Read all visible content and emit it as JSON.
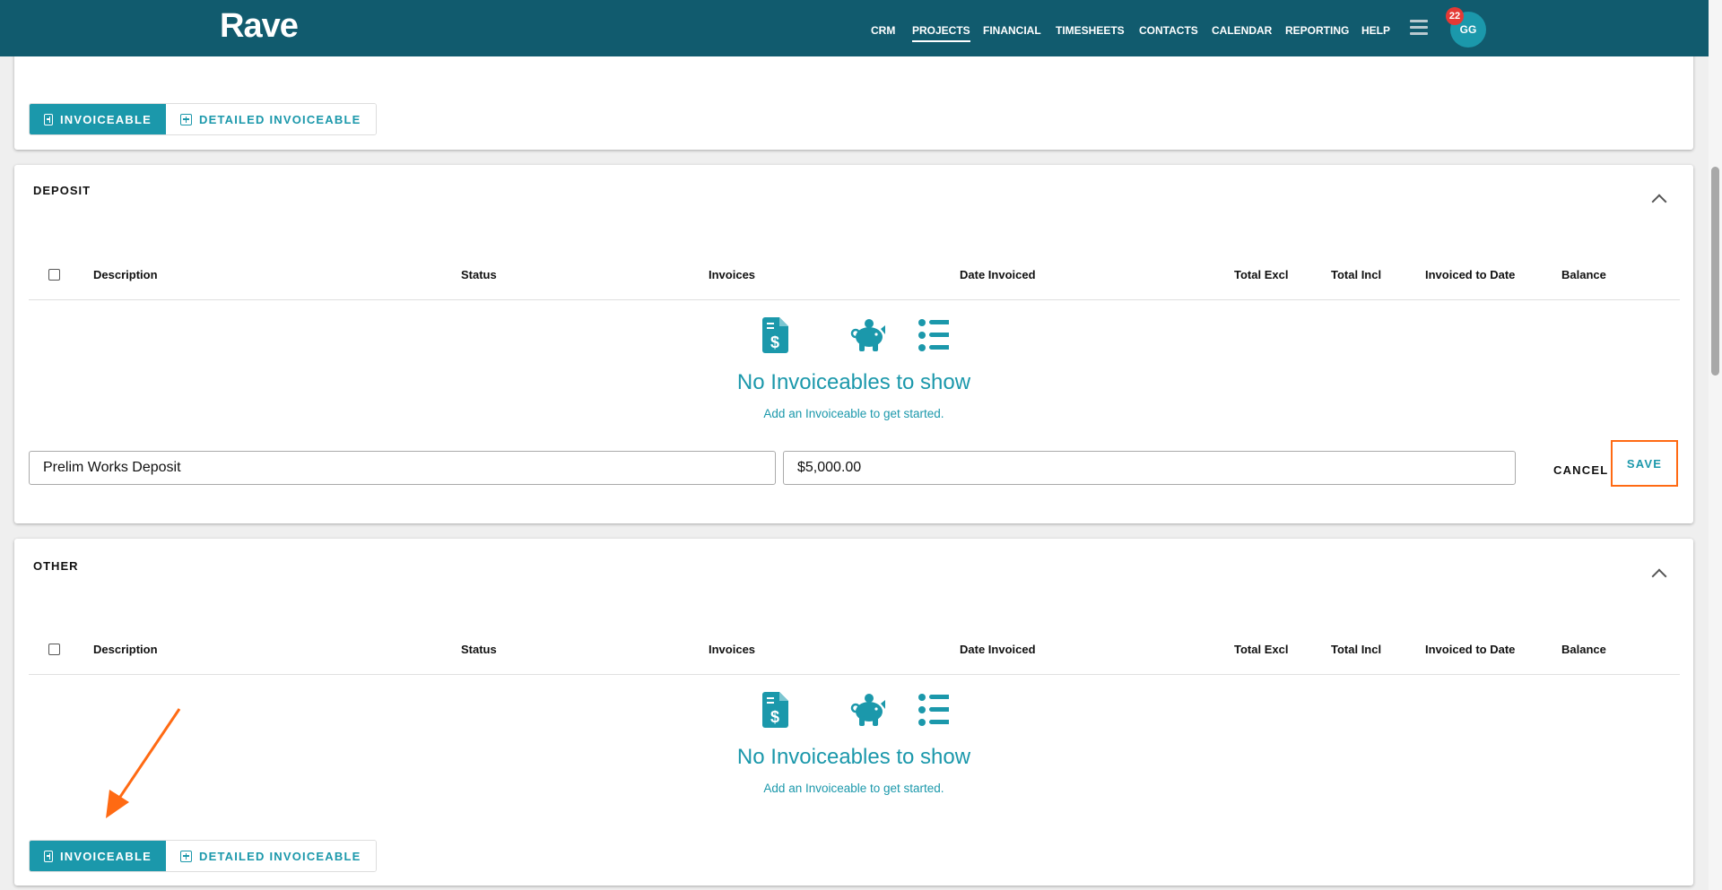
{
  "header": {
    "logo": "Rave",
    "nav": [
      "CRM",
      "PROJECTS",
      "FINANCIAL",
      "TIMESHEETS",
      "CONTACTS",
      "CALENDAR",
      "REPORTING",
      "HELP"
    ],
    "active": "PROJECTS",
    "avatar_initials": "GG",
    "notification_count": "22"
  },
  "buttons": {
    "invoiceable": "INVOICEABLE",
    "detailed_invoiceable": "DETAILED INVOICEABLE",
    "cancel": "CANCEL",
    "save": "SAVE"
  },
  "table_headers": [
    "Description",
    "Status",
    "Invoices",
    "Date Invoiced",
    "Total Excl",
    "Total Incl",
    "Invoiced to Date",
    "Balance"
  ],
  "empty": {
    "title": "No Invoiceables to show",
    "subtitle": "Add an Invoiceable to get started.",
    "icons": [
      "invoice-dollar-icon",
      "piggy-bank-icon",
      "list-icon"
    ]
  },
  "deposit": {
    "title": "DEPOSIT",
    "description_value": "Prelim Works Deposit",
    "amount_value": "$5,000.00"
  },
  "other": {
    "title": "OTHER"
  },
  "colors": {
    "brand": "#115b6e",
    "accent": "#1b98ab",
    "highlight": "#ff6a13"
  }
}
